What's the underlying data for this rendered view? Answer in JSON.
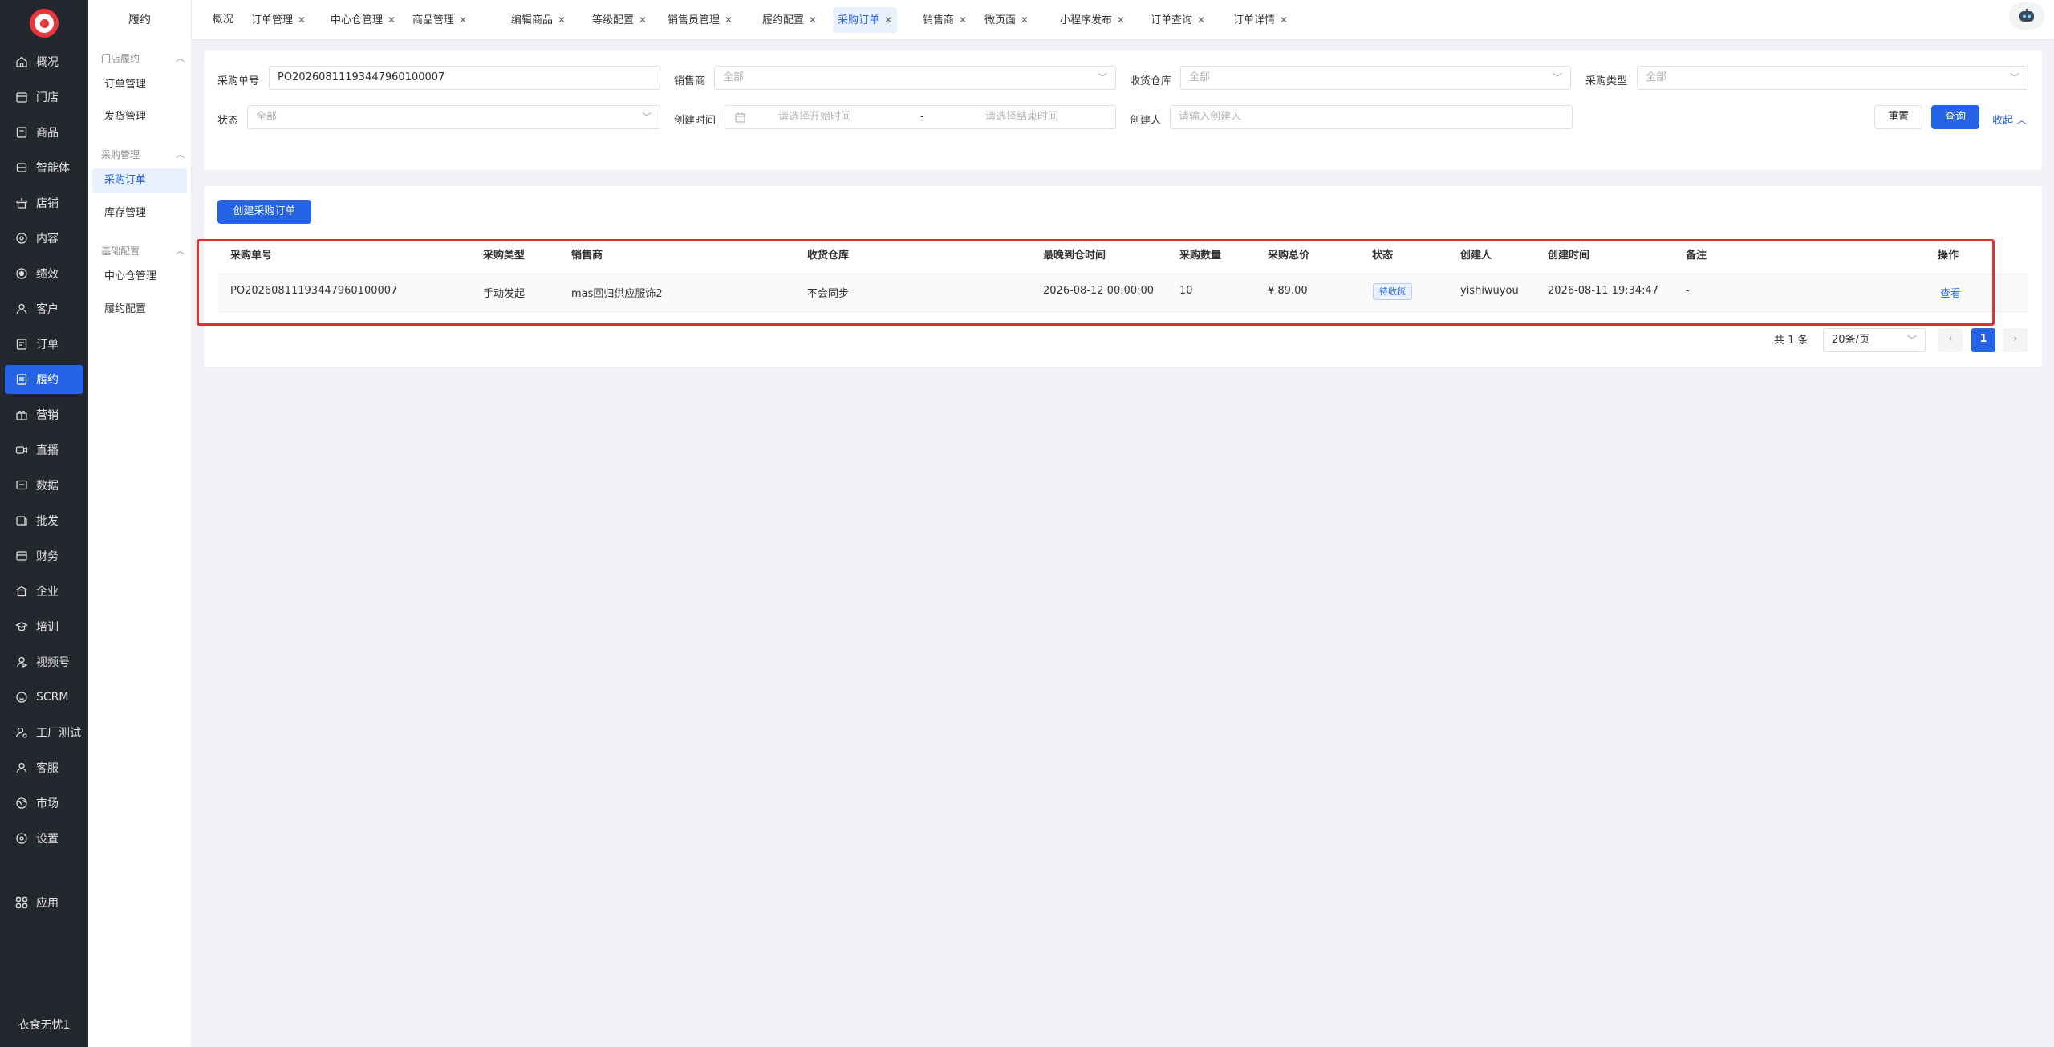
{
  "sidebar": {
    "items": [
      {
        "label": "概况",
        "icon": "home-icon"
      },
      {
        "label": "门店",
        "icon": "store-icon"
      },
      {
        "label": "商品",
        "icon": "goods-icon"
      },
      {
        "label": "智能体",
        "icon": "agent-icon"
      },
      {
        "label": "店铺",
        "icon": "shop-icon"
      },
      {
        "label": "内容",
        "icon": "content-icon"
      },
      {
        "label": "绩效",
        "icon": "performance-icon"
      },
      {
        "label": "客户",
        "icon": "customer-icon"
      },
      {
        "label": "订单",
        "icon": "order-icon"
      },
      {
        "label": "履约",
        "icon": "fulfillment-icon"
      },
      {
        "label": "营销",
        "icon": "gift-icon"
      },
      {
        "label": "直播",
        "icon": "live-icon"
      },
      {
        "label": "数据",
        "icon": "data-icon"
      },
      {
        "label": "批发",
        "icon": "wholesale-icon"
      },
      {
        "label": "财务",
        "icon": "finance-icon"
      },
      {
        "label": "企业",
        "icon": "enterprise-icon"
      },
      {
        "label": "培训",
        "icon": "training-icon"
      },
      {
        "label": "视频号",
        "icon": "video-icon"
      },
      {
        "label": "SCRM",
        "icon": "scrm-icon"
      },
      {
        "label": "工厂测试",
        "icon": "factory-icon"
      },
      {
        "label": "客服",
        "icon": "service-icon"
      },
      {
        "label": "市场",
        "icon": "market-icon"
      },
      {
        "label": "设置",
        "icon": "settings-icon"
      }
    ],
    "apps_label": "应用",
    "footer": "衣食无忧1"
  },
  "subnav": {
    "title": "履约",
    "groups": [
      {
        "label": "门店履约",
        "items": [
          "订单管理",
          "发货管理"
        ]
      },
      {
        "label": "采购管理",
        "items": [
          "采购订单",
          "库存管理"
        ]
      },
      {
        "label": "基础配置",
        "items": [
          "中心仓管理",
          "履约配置"
        ]
      }
    ]
  },
  "tabs": [
    {
      "label": "概况",
      "closable": false
    },
    {
      "label": "订单管理",
      "closable": true
    },
    {
      "label": "中心仓管理",
      "closable": true
    },
    {
      "label": "商品管理",
      "closable": true
    },
    {
      "label": "编辑商品",
      "closable": true
    },
    {
      "label": "等级配置",
      "closable": true
    },
    {
      "label": "销售员管理",
      "closable": true
    },
    {
      "label": "履约配置",
      "closable": true
    },
    {
      "label": "采购订单",
      "closable": true,
      "active": true
    },
    {
      "label": "销售商",
      "closable": true
    },
    {
      "label": "微页面",
      "closable": true
    },
    {
      "label": "小程序发布",
      "closable": true
    },
    {
      "label": "订单查询",
      "closable": true
    },
    {
      "label": "订单详情",
      "closable": true
    }
  ],
  "filter": {
    "po_label": "采购单号",
    "po_value": "PO2026081119344796010000 7",
    "seller_label": "销售商",
    "seller_value": "全部",
    "warehouse_label": "收货仓库",
    "warehouse_value": "全部",
    "type_label": "采购类型",
    "type_value": "全部",
    "status_label": "状态",
    "status_value": "全部",
    "ctime_label": "创建时间",
    "start_placeholder": "请选择开始时间",
    "range_sep": "-",
    "end_placeholder": "请选择结束时间",
    "creator_label": "创建人",
    "creator_placeholder": "请输入创建人",
    "reset": "重置",
    "search": "查询",
    "collapse": "收起"
  },
  "create_button": "创建采购订单",
  "table": {
    "columns": [
      "采购单号",
      "采购类型",
      "销售商",
      "收货仓库",
      "最晚到仓时间",
      "采购数量",
      "采购总价",
      "状态",
      "创建人",
      "创建时间",
      "备注",
      "操作"
    ],
    "rows": [
      {
        "po": "PO20260811193447960100007",
        "type": "手动发起",
        "seller": "mas回归供应服饰2",
        "warehouse": "不会同步",
        "deadline": "2026-08-12 00:00:00",
        "qty": "10",
        "total": "¥ 89.00",
        "status": "待收货",
        "creator": "yishiwuyou",
        "created": "2026-08-11 19:34:47",
        "note": "-",
        "action": "查看"
      }
    ]
  },
  "pager": {
    "total": "共 1 条",
    "size": "20条/页",
    "current": "1"
  },
  "colors": {
    "accent": "#2462e6",
    "sidebar_bg": "#25272e",
    "highlight": "#e03131",
    "logo": "#e8383d"
  }
}
